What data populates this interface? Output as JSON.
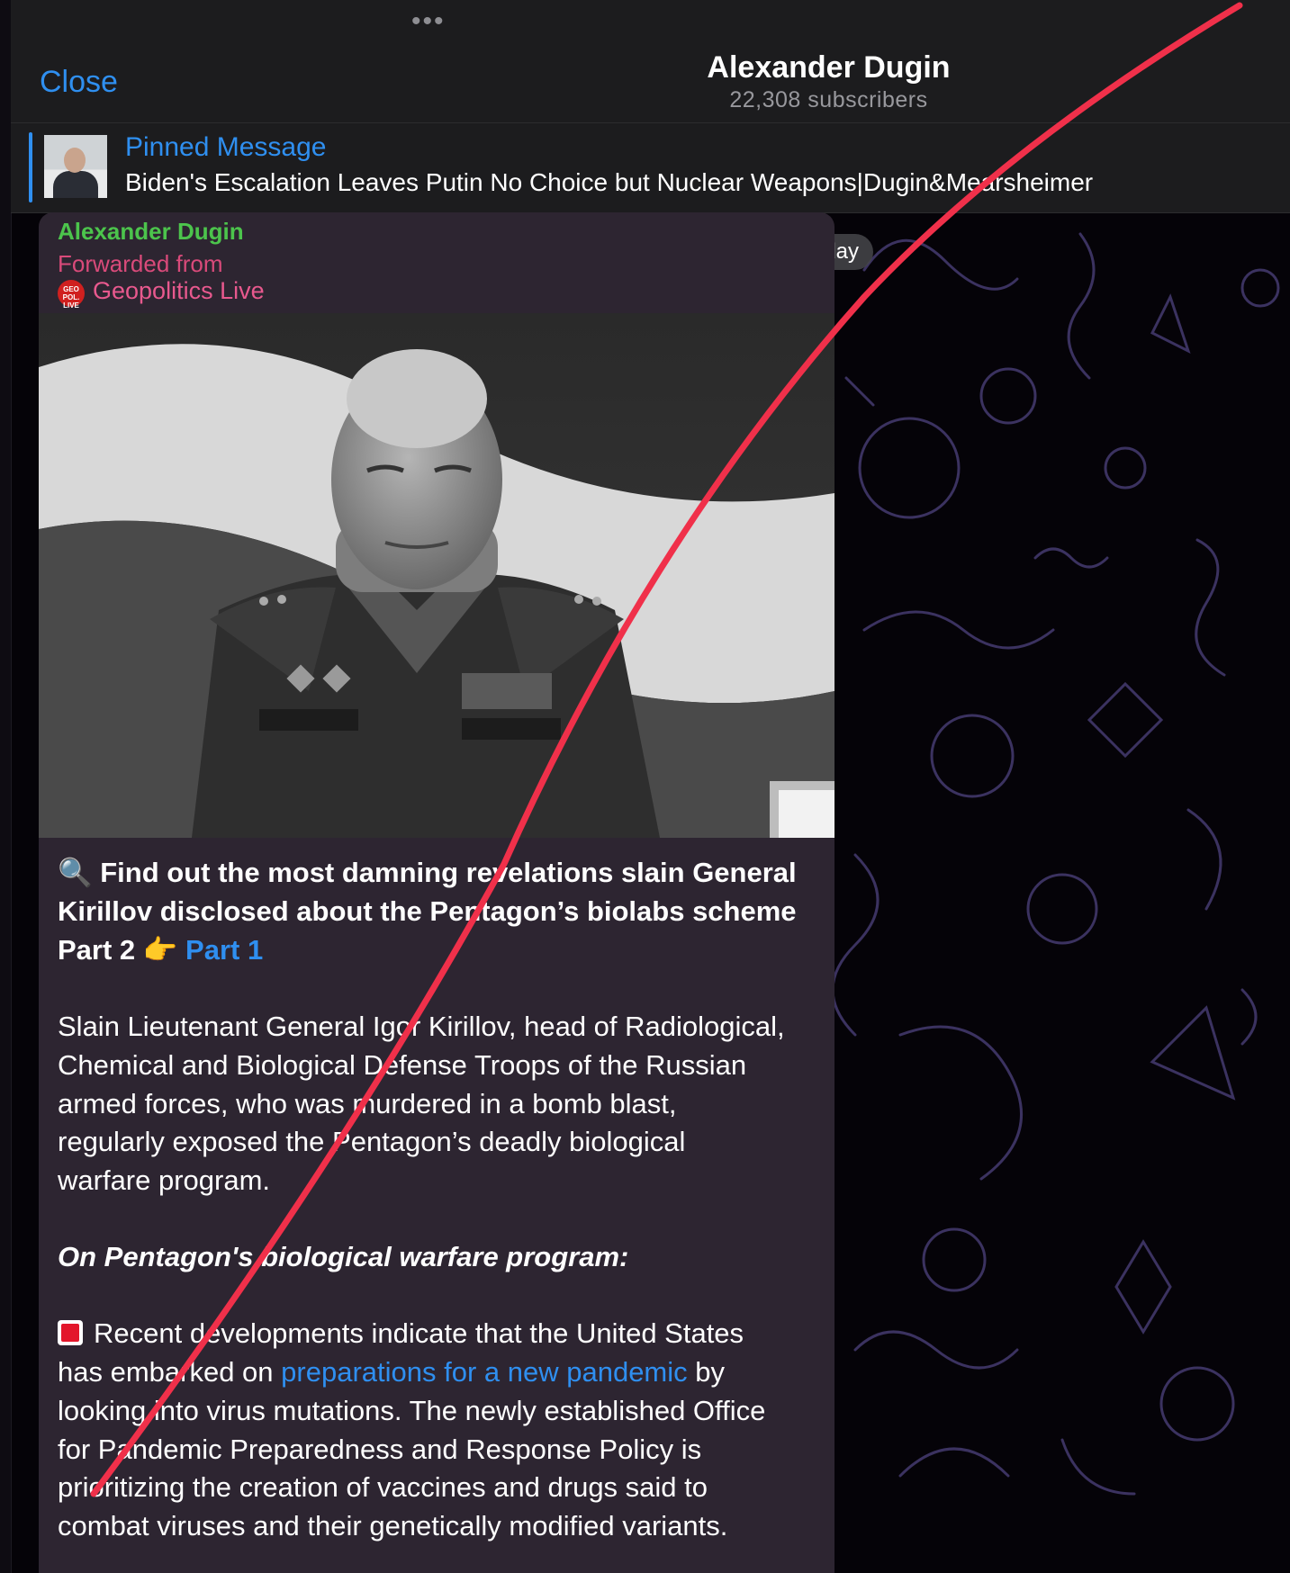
{
  "header": {
    "close_label": "Close",
    "grabber": "•••",
    "title": "Alexander Dugin",
    "subtitle": "22,308 subscribers"
  },
  "pinned": {
    "label": "Pinned Message",
    "text": "Biden's Escalation Leaves Putin No Choice but Nuclear Weapons|Dugin&Mearsheimer"
  },
  "date_badge": "Today",
  "message": {
    "sender": "Alexander Dugin",
    "forwarded_label": "Forwarded from",
    "forwarded_channel": "Geopolitics Live",
    "channel_avatar_text": "GEO POLITICS LIVE",
    "headline": {
      "icon": "magnifier-icon",
      "line1": "Find out the most damning revelations slain General",
      "line2": "Kirillov disclosed about the Pentagon’s biolabs scheme",
      "part2_label": "Part 2",
      "pointing_icon": "backhand-index-pointing-right-icon",
      "part1_link": "Part 1"
    },
    "paragraph1": [
      "Slain Lieutenant General Igor Kirillov, head of Radiological,",
      "Chemical and Biological Defense Troops of the Russian",
      "armed forces, who was murdered in a bomb blast,",
      "regularly exposed the Pentagon’s deadly biological",
      "warfare program."
    ],
    "section_heading": "On Pentagon's biological warfare program:",
    "bullet": {
      "icon": "red-square-icon",
      "line1": "Recent developments indicate that the United States",
      "line2_before": "has embarked on ",
      "line2_link": "preparations for a new pandemic",
      "line2_after": " by",
      "line3": "looking into virus mutations. The newly established Office",
      "line4": "for Pandemic Preparedness and Response Policy is",
      "line5": "prioritizing the creation of vaccines and drugs said to",
      "line6": "combat viruses and their genetically modified variants."
    }
  },
  "colors": {
    "link": "#2f8ff0",
    "sender": "#4cc44c",
    "forwarded": "#e8598e",
    "bubble": "#2d2531",
    "strike": "#f0304a"
  }
}
